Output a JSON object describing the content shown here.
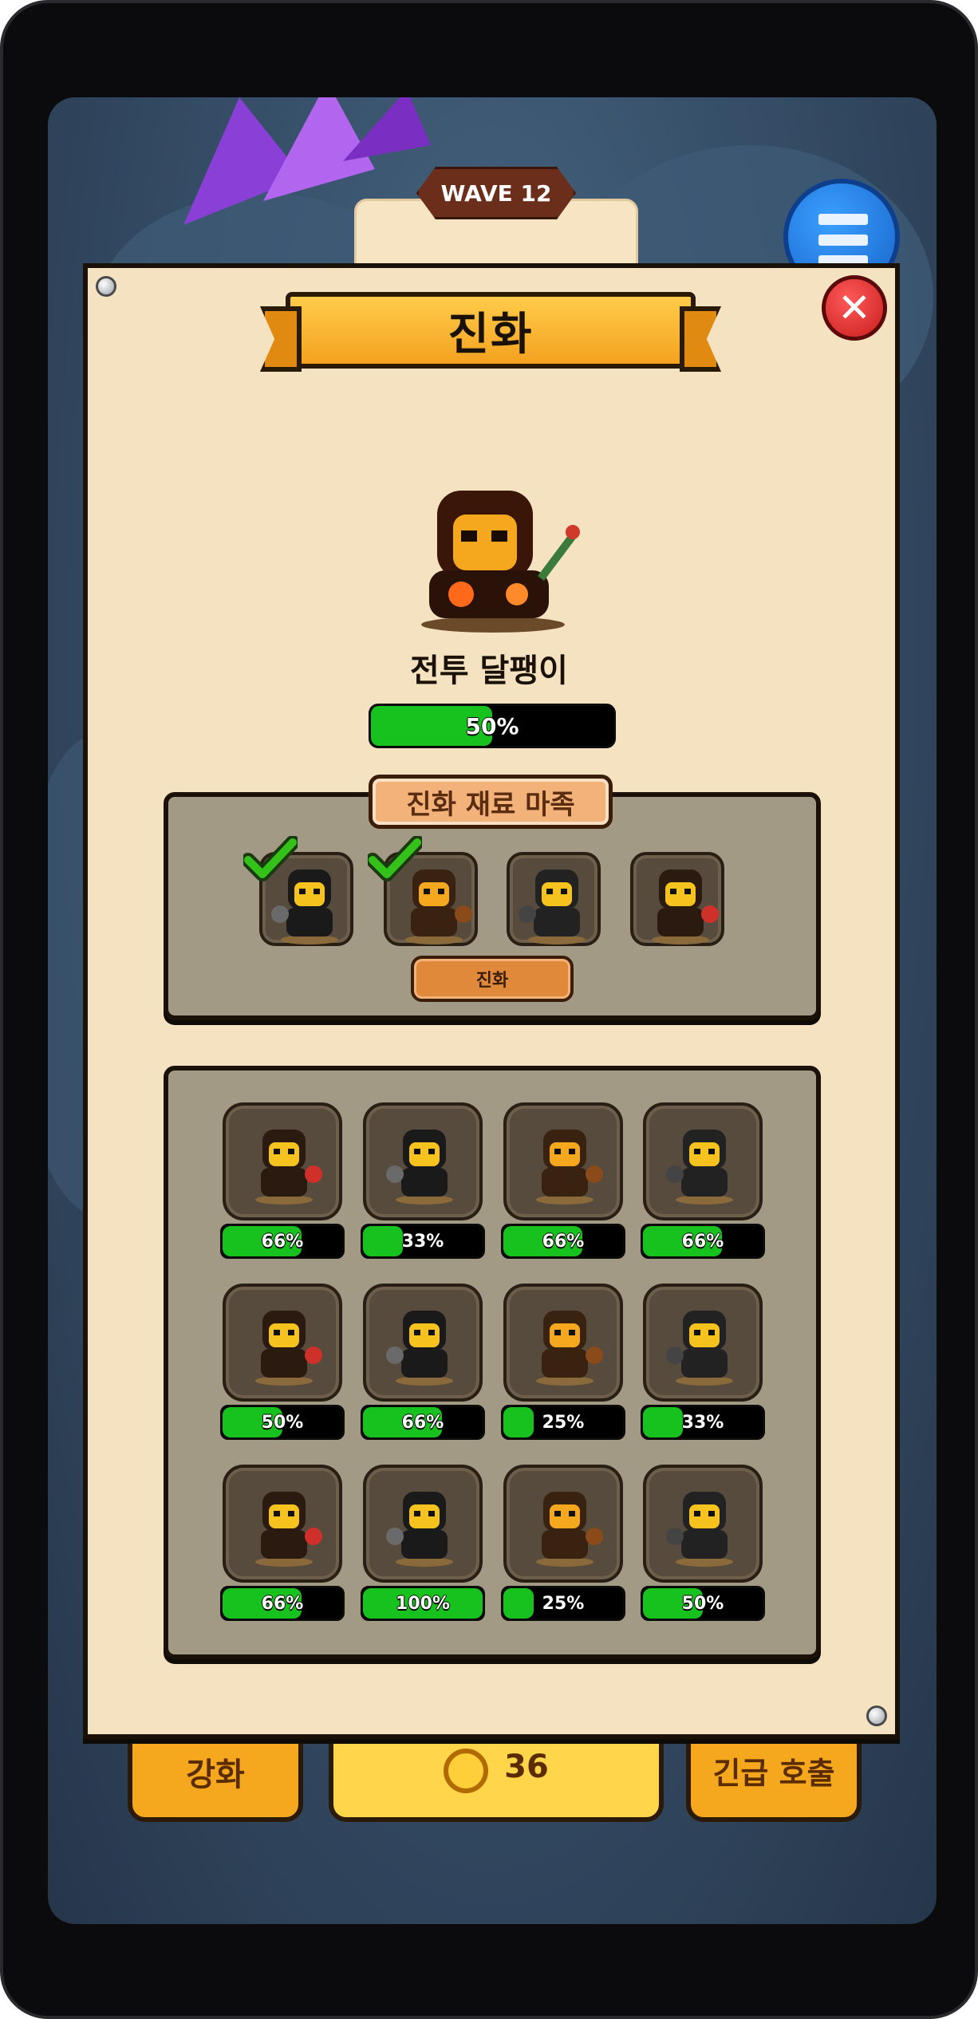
{
  "hud": {
    "wave_label": "WAVE 12"
  },
  "panel": {
    "title": "진화",
    "close_icon": "✕"
  },
  "hero": {
    "name": "전투 달팽이",
    "progress": 0.5,
    "progress_label": "50%"
  },
  "materials": {
    "label": "진화 재료 마족",
    "slots": [
      {
        "icon": "rider-unit",
        "checked": true
      },
      {
        "icon": "white-wolf-unit",
        "checked": true
      },
      {
        "icon": "rabbit-unit",
        "checked": false
      },
      {
        "icon": "ghost-unit",
        "checked": false
      }
    ],
    "evolve_button": "진화"
  },
  "units": [
    {
      "icon": "horned-warrior-unit",
      "progress": 0.66,
      "label": "66%"
    },
    {
      "icon": "axe-soldier-unit",
      "progress": 0.33,
      "label": "33%"
    },
    {
      "icon": "cowboy-unit",
      "progress": 0.66,
      "label": "66%"
    },
    {
      "icon": "shield-knight-unit",
      "progress": 0.66,
      "label": "66%"
    },
    {
      "icon": "pigtail-girl-unit",
      "progress": 0.5,
      "label": "50%"
    },
    {
      "icon": "ninja-unit",
      "progress": 0.66,
      "label": "66%"
    },
    {
      "icon": "axe-warrior-unit",
      "progress": 0.25,
      "label": "25%"
    },
    {
      "icon": "gunslinger-unit",
      "progress": 0.33,
      "label": "33%"
    },
    {
      "icon": "chick-unit",
      "progress": 0.66,
      "label": "66%"
    },
    {
      "icon": "horse-rider-unit",
      "progress": 1.0,
      "label": "100%"
    },
    {
      "icon": "bear-warrior-unit",
      "progress": 0.25,
      "label": "25%"
    },
    {
      "icon": "fire-snail-unit",
      "progress": 0.5,
      "label": "50%"
    }
  ],
  "bottom": {
    "left_label": "강화",
    "center_value": "36",
    "right_label": "긴급 호출"
  },
  "colors": {
    "panel_bg": "#f5e2c0",
    "progress_green": "#18c21e",
    "ribbon": "#f3a21f",
    "close_red": "#c81c1c"
  }
}
